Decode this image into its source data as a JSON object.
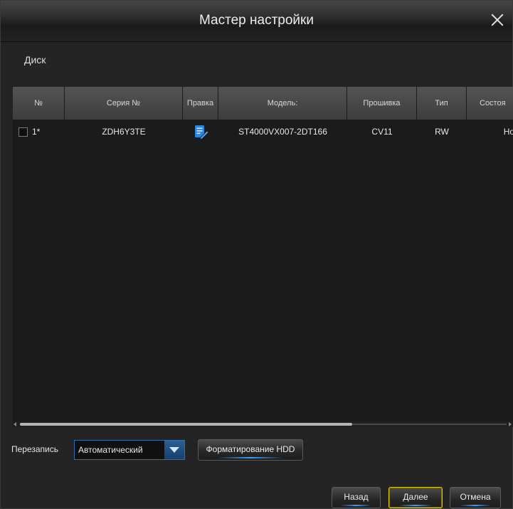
{
  "window": {
    "title": "Мастер настройки"
  },
  "section": {
    "label": "Диск"
  },
  "table": {
    "columns": [
      "№",
      "Серия №",
      "Правка",
      "Модель:",
      "Прошивка",
      "Тип",
      "Состоя"
    ],
    "rows": [
      {
        "no": "1*",
        "serial": "ZDH6Y3TE",
        "model": "ST4000VX007-2DT166",
        "firmware": "CV11",
        "type": "RW",
        "status": "Норм",
        "checked": false
      }
    ],
    "scroll_position": 0
  },
  "overwrite": {
    "label": "Перезапись",
    "value": "Автоматический"
  },
  "buttons": {
    "format": "Форматирование HDD",
    "back": "Назад",
    "next": "Далее",
    "cancel": "Отмена"
  },
  "colors": {
    "accent": "#2f6fb0",
    "focus": "#e7c400",
    "edit_icon": "#2b86e0"
  },
  "icons": {
    "close": "close-icon",
    "edit": "edit-icon",
    "dropdown": "chevron-down-icon"
  }
}
